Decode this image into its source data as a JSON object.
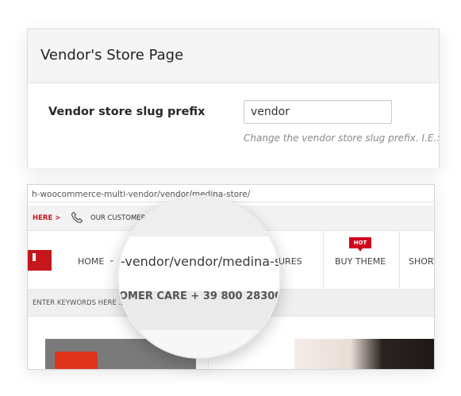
{
  "settings": {
    "title": "Vendor's Store Page",
    "field_label": "Vendor store slug prefix",
    "field_value": "vendor",
    "field_description": "Change the vendor store slug prefix. I.E.:"
  },
  "browser": {
    "url_fragment": "h-woocommerce-multi-vendor/vendor/medina-store/",
    "topbar": {
      "here_link": "HERE >",
      "customer_text": "OUR CUSTOMER"
    },
    "nav": {
      "home": "HOME",
      "features": "URES",
      "hot_badge": "HOT",
      "buy_theme": "BUY THEME",
      "short": "SHORT"
    },
    "search_placeholder": "ENTER KEYWORDS HERE ..."
  },
  "lens": {
    "url_zoom": "-vendor/vendor/medina-s",
    "customer_care": "OMER CARE + 39 800 28300"
  },
  "colors": {
    "brand_red": "#c4161c",
    "hot_red": "#d0021b"
  }
}
